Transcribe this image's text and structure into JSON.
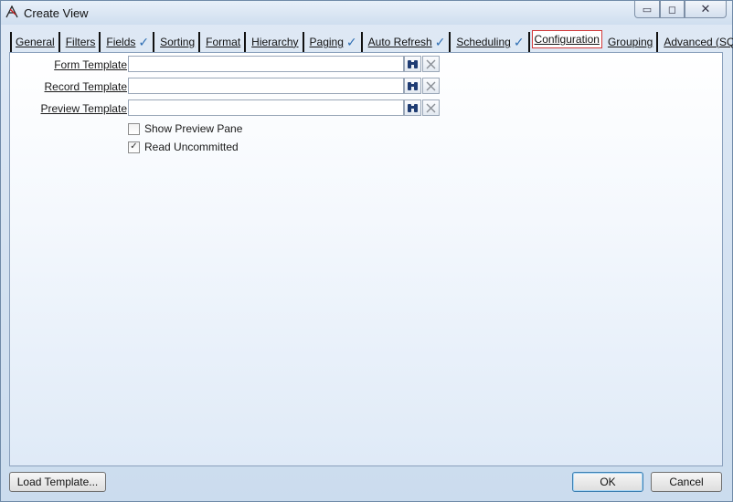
{
  "window": {
    "title": "Create View",
    "controls": {
      "minimize": "▭",
      "maximize": "◻",
      "close": "✕"
    }
  },
  "tabs": [
    {
      "label": "General",
      "checked": false,
      "active": false
    },
    {
      "label": "Filters",
      "checked": false,
      "active": false
    },
    {
      "label": "Fields",
      "checked": true,
      "active": false
    },
    {
      "label": "Sorting",
      "checked": false,
      "active": false
    },
    {
      "label": "Format",
      "checked": false,
      "active": false
    },
    {
      "label": "Hierarchy",
      "checked": false,
      "active": false
    },
    {
      "label": "Paging",
      "checked": true,
      "active": false
    },
    {
      "label": "Auto Refresh",
      "checked": true,
      "active": false
    },
    {
      "label": "Scheduling",
      "checked": true,
      "active": false
    },
    {
      "label": "Configuration",
      "checked": false,
      "active": true
    },
    {
      "label": "Grouping",
      "checked": false,
      "active": false
    },
    {
      "label": "Advanced (SQL)",
      "checked": false,
      "active": false
    }
  ],
  "config": {
    "form_template": {
      "label": "Form Template",
      "value": ""
    },
    "record_template": {
      "label": "Record Template",
      "value": ""
    },
    "preview_template": {
      "label": "Preview Template",
      "value": ""
    },
    "show_preview_pane": {
      "label": "Show Preview Pane",
      "checked": false
    },
    "read_uncommitted": {
      "label": "Read Uncommitted",
      "checked": true
    }
  },
  "footer": {
    "load_template": "Load Template...",
    "ok": "OK",
    "cancel": "Cancel"
  },
  "icons": {
    "find": "binoculars-icon",
    "clear": "close-icon",
    "check": "checkmark-icon"
  },
  "colors": {
    "active_tab_border": "#d23a3a",
    "check": "#2f6fb3",
    "panel_border": "#8aa0bc"
  }
}
